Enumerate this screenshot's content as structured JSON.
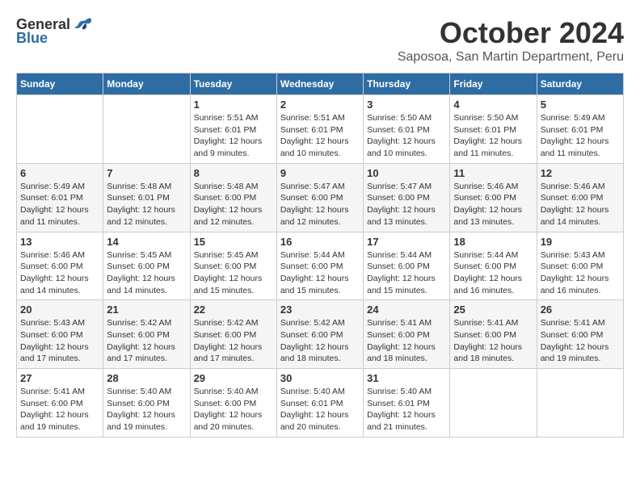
{
  "logo": {
    "general": "General",
    "blue": "Blue"
  },
  "header": {
    "month": "October 2024",
    "location": "Saposoa, San Martin Department, Peru"
  },
  "weekdays": [
    "Sunday",
    "Monday",
    "Tuesday",
    "Wednesday",
    "Thursday",
    "Friday",
    "Saturday"
  ],
  "weeks": [
    [
      {
        "day": "",
        "info": ""
      },
      {
        "day": "",
        "info": ""
      },
      {
        "day": "1",
        "info": "Sunrise: 5:51 AM\nSunset: 6:01 PM\nDaylight: 12 hours\nand 9 minutes."
      },
      {
        "day": "2",
        "info": "Sunrise: 5:51 AM\nSunset: 6:01 PM\nDaylight: 12 hours\nand 10 minutes."
      },
      {
        "day": "3",
        "info": "Sunrise: 5:50 AM\nSunset: 6:01 PM\nDaylight: 12 hours\nand 10 minutes."
      },
      {
        "day": "4",
        "info": "Sunrise: 5:50 AM\nSunset: 6:01 PM\nDaylight: 12 hours\nand 11 minutes."
      },
      {
        "day": "5",
        "info": "Sunrise: 5:49 AM\nSunset: 6:01 PM\nDaylight: 12 hours\nand 11 minutes."
      }
    ],
    [
      {
        "day": "6",
        "info": "Sunrise: 5:49 AM\nSunset: 6:01 PM\nDaylight: 12 hours\nand 11 minutes."
      },
      {
        "day": "7",
        "info": "Sunrise: 5:48 AM\nSunset: 6:01 PM\nDaylight: 12 hours\nand 12 minutes."
      },
      {
        "day": "8",
        "info": "Sunrise: 5:48 AM\nSunset: 6:00 PM\nDaylight: 12 hours\nand 12 minutes."
      },
      {
        "day": "9",
        "info": "Sunrise: 5:47 AM\nSunset: 6:00 PM\nDaylight: 12 hours\nand 12 minutes."
      },
      {
        "day": "10",
        "info": "Sunrise: 5:47 AM\nSunset: 6:00 PM\nDaylight: 12 hours\nand 13 minutes."
      },
      {
        "day": "11",
        "info": "Sunrise: 5:46 AM\nSunset: 6:00 PM\nDaylight: 12 hours\nand 13 minutes."
      },
      {
        "day": "12",
        "info": "Sunrise: 5:46 AM\nSunset: 6:00 PM\nDaylight: 12 hours\nand 14 minutes."
      }
    ],
    [
      {
        "day": "13",
        "info": "Sunrise: 5:46 AM\nSunset: 6:00 PM\nDaylight: 12 hours\nand 14 minutes."
      },
      {
        "day": "14",
        "info": "Sunrise: 5:45 AM\nSunset: 6:00 PM\nDaylight: 12 hours\nand 14 minutes."
      },
      {
        "day": "15",
        "info": "Sunrise: 5:45 AM\nSunset: 6:00 PM\nDaylight: 12 hours\nand 15 minutes."
      },
      {
        "day": "16",
        "info": "Sunrise: 5:44 AM\nSunset: 6:00 PM\nDaylight: 12 hours\nand 15 minutes."
      },
      {
        "day": "17",
        "info": "Sunrise: 5:44 AM\nSunset: 6:00 PM\nDaylight: 12 hours\nand 15 minutes."
      },
      {
        "day": "18",
        "info": "Sunrise: 5:44 AM\nSunset: 6:00 PM\nDaylight: 12 hours\nand 16 minutes."
      },
      {
        "day": "19",
        "info": "Sunrise: 5:43 AM\nSunset: 6:00 PM\nDaylight: 12 hours\nand 16 minutes."
      }
    ],
    [
      {
        "day": "20",
        "info": "Sunrise: 5:43 AM\nSunset: 6:00 PM\nDaylight: 12 hours\nand 17 minutes."
      },
      {
        "day": "21",
        "info": "Sunrise: 5:42 AM\nSunset: 6:00 PM\nDaylight: 12 hours\nand 17 minutes."
      },
      {
        "day": "22",
        "info": "Sunrise: 5:42 AM\nSunset: 6:00 PM\nDaylight: 12 hours\nand 17 minutes."
      },
      {
        "day": "23",
        "info": "Sunrise: 5:42 AM\nSunset: 6:00 PM\nDaylight: 12 hours\nand 18 minutes."
      },
      {
        "day": "24",
        "info": "Sunrise: 5:41 AM\nSunset: 6:00 PM\nDaylight: 12 hours\nand 18 minutes."
      },
      {
        "day": "25",
        "info": "Sunrise: 5:41 AM\nSunset: 6:00 PM\nDaylight: 12 hours\nand 18 minutes."
      },
      {
        "day": "26",
        "info": "Sunrise: 5:41 AM\nSunset: 6:00 PM\nDaylight: 12 hours\nand 19 minutes."
      }
    ],
    [
      {
        "day": "27",
        "info": "Sunrise: 5:41 AM\nSunset: 6:00 PM\nDaylight: 12 hours\nand 19 minutes."
      },
      {
        "day": "28",
        "info": "Sunrise: 5:40 AM\nSunset: 6:00 PM\nDaylight: 12 hours\nand 19 minutes."
      },
      {
        "day": "29",
        "info": "Sunrise: 5:40 AM\nSunset: 6:00 PM\nDaylight: 12 hours\nand 20 minutes."
      },
      {
        "day": "30",
        "info": "Sunrise: 5:40 AM\nSunset: 6:01 PM\nDaylight: 12 hours\nand 20 minutes."
      },
      {
        "day": "31",
        "info": "Sunrise: 5:40 AM\nSunset: 6:01 PM\nDaylight: 12 hours\nand 21 minutes."
      },
      {
        "day": "",
        "info": ""
      },
      {
        "day": "",
        "info": ""
      }
    ]
  ]
}
